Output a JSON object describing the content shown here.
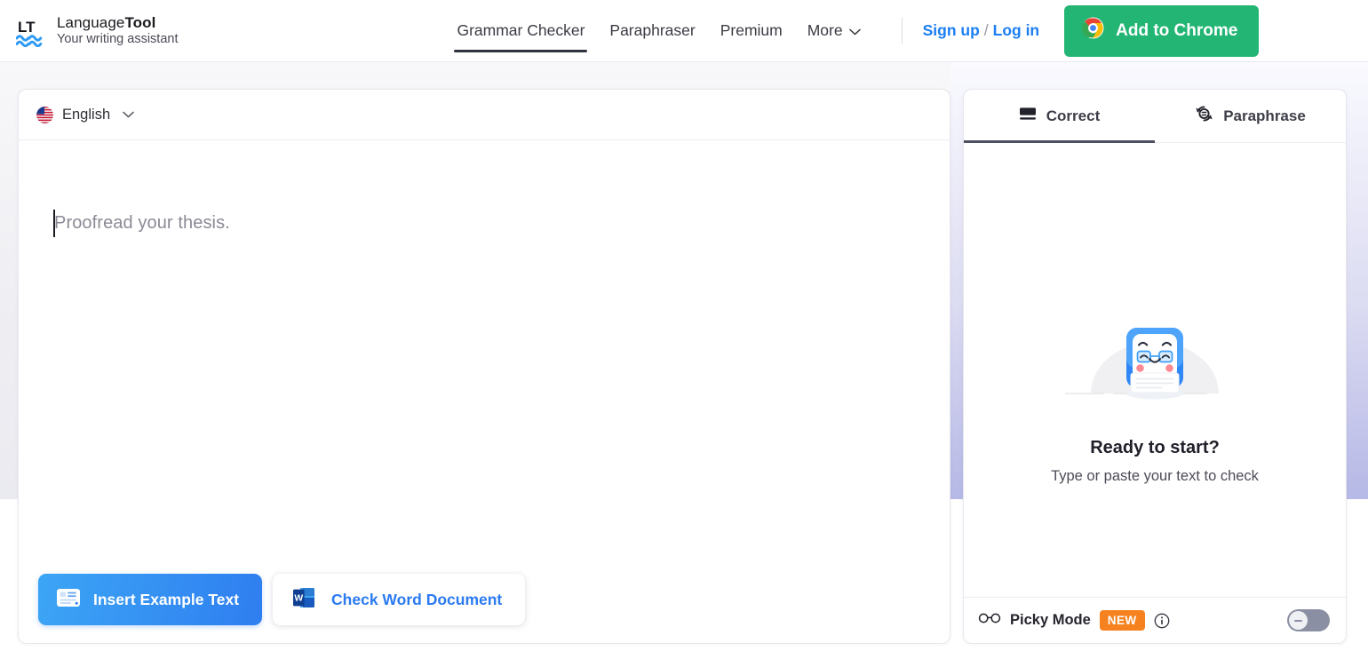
{
  "brand": {
    "logo_icon": "lt-wave-logo",
    "name_light": "Language",
    "name_bold": "Tool",
    "tagline": "Your writing assistant"
  },
  "nav": {
    "items": [
      {
        "label": "Grammar Checker",
        "active": true,
        "has_chevron": false
      },
      {
        "label": "Paraphraser",
        "active": false,
        "has_chevron": false
      },
      {
        "label": "Premium",
        "active": false,
        "has_chevron": false
      },
      {
        "label": "More",
        "active": false,
        "has_chevron": true
      }
    ],
    "chevron_icon": "chevron-down-icon"
  },
  "auth": {
    "signup_label": "Sign up",
    "separator": "/",
    "login_label": "Log in",
    "link_color": "#1c7ef3"
  },
  "chrome_button": {
    "label": "Add to Chrome",
    "icon": "chrome-icon",
    "background": "#22b573"
  },
  "editor": {
    "language": {
      "flag_icon": "us-flag-icon",
      "label": "English",
      "chevron_icon": "chevron-down-icon"
    },
    "placeholder": "Proofread your thesis.",
    "caret_visible": true,
    "actions": {
      "insert_example": {
        "label": "Insert Example Text",
        "icon": "document-lines-icon"
      },
      "check_word": {
        "label": "Check Word Document",
        "icon": "word-doc-icon"
      }
    }
  },
  "side_panel": {
    "tabs": [
      {
        "label": "Correct",
        "icon": "correct-underline-icon",
        "active": true
      },
      {
        "label": "Paraphrase",
        "icon": "paraphrase-refresh-icon",
        "active": false
      }
    ],
    "empty_state": {
      "illustration": "robot-mascot-illustration",
      "title": "Ready to start?",
      "subtitle": "Type or paste your text to check"
    },
    "picky_mode": {
      "icon": "glasses-icon",
      "label": "Picky Mode",
      "badge": "NEW",
      "badge_color": "#f5821f",
      "info_icon": "info-circle-icon",
      "toggle_state": "off"
    }
  }
}
